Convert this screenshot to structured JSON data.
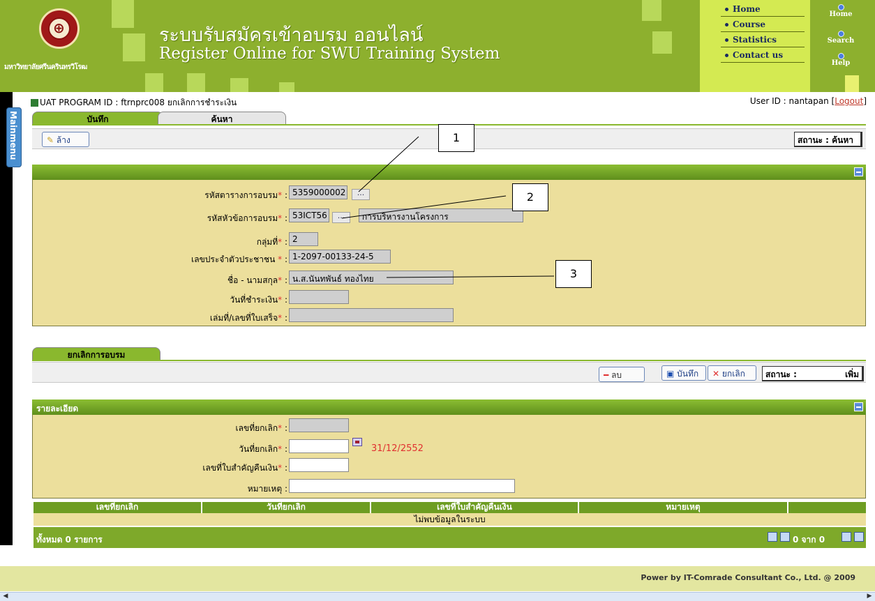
{
  "header": {
    "university_name": "มหาวิทยาลัยศรีนครินทรวิโรฒ",
    "title_th": "ระบบรับสมัครเข้าอบรม ออนไลน์",
    "title_en": "Register Online for SWU Training System",
    "topnav": [
      "Home",
      "Course",
      "Statistics",
      "Contact us"
    ],
    "sidenav": [
      "Home",
      "Search",
      "Help"
    ]
  },
  "sidebar": {
    "mainmenu_label": "Mainmenu"
  },
  "breadcrumb": "UAT   PROGRAM ID : ftrnprc008 ยกเลิกการชำระเงิน",
  "user": {
    "prefix": "User ID : nantapan [",
    "logout": "Logout",
    "suffix": "]"
  },
  "tabs": [
    "บันทึก",
    "ค้นหา"
  ],
  "toolbar1": {
    "clear_label": "ล้าง",
    "status_label": "สถานะ : ค้นหา"
  },
  "form": {
    "fields": [
      {
        "label": "รหัสตารางการอบรม",
        "value": "5359000002"
      },
      {
        "label": "รหัสหัวข้อการอบรม",
        "value": "53ICT56",
        "name_value": "การบริหารงานโครงการ"
      },
      {
        "label": "กลุ่มที่",
        "value": "2"
      },
      {
        "label": "เลขประจำตัวประชาชน ",
        "value": "1-2097-00133-24-5"
      },
      {
        "label": "ชื่อ - นามสกุล",
        "value": "น.ส.นันทพันธ์  ทองไทย"
      },
      {
        "label": "วันที่ชำระเงิน",
        "value": ""
      },
      {
        "label": "เล่มที่/เลขที่ใบเสร็จ",
        "value": ""
      }
    ],
    "required_mark": "*",
    "colon": " :",
    "lookup": "..."
  },
  "callouts": [
    "1",
    "2",
    "3"
  ],
  "section2": {
    "tab": "ยกเลิกการอบรม",
    "delete_label": "ลบ",
    "save_label": "บันทึก",
    "cancel_label": "ยกเลิก",
    "status_label": "สถานะ :",
    "status_value": "เพิ่ม"
  },
  "detail": {
    "title": "รายละเอียด",
    "fields": [
      {
        "label": "เลขที่ยกเลิก",
        "value": ""
      },
      {
        "label": "วันที่ยกเลิก",
        "value": ""
      },
      {
        "label": "เลขที่ใบสำคัญคืนเงิน",
        "value": ""
      },
      {
        "label": "หมายเหตุ",
        "value": ""
      }
    ],
    "date_hint": "31/12/2552",
    "date_hint_color": "#e03030"
  },
  "grid": {
    "columns": [
      "เลขที่ยกเลิก",
      "วันที่ยกเลิก",
      "เลขที่ใบสำคัญคืนเงิน",
      "หมายเหตุ",
      ""
    ],
    "empty_message": "ไม่พบข้อมูลในระบบ",
    "total_label": "ทั้งหมด  0  รายการ",
    "pager": "0 จาก 0"
  },
  "footer": "Power by IT-Comrade Consultant Co., Ltd. @ 2009",
  "colors": {
    "header_green": "#8db02e",
    "panel_yellow": "#ecdf9c",
    "required": "#e03030"
  }
}
